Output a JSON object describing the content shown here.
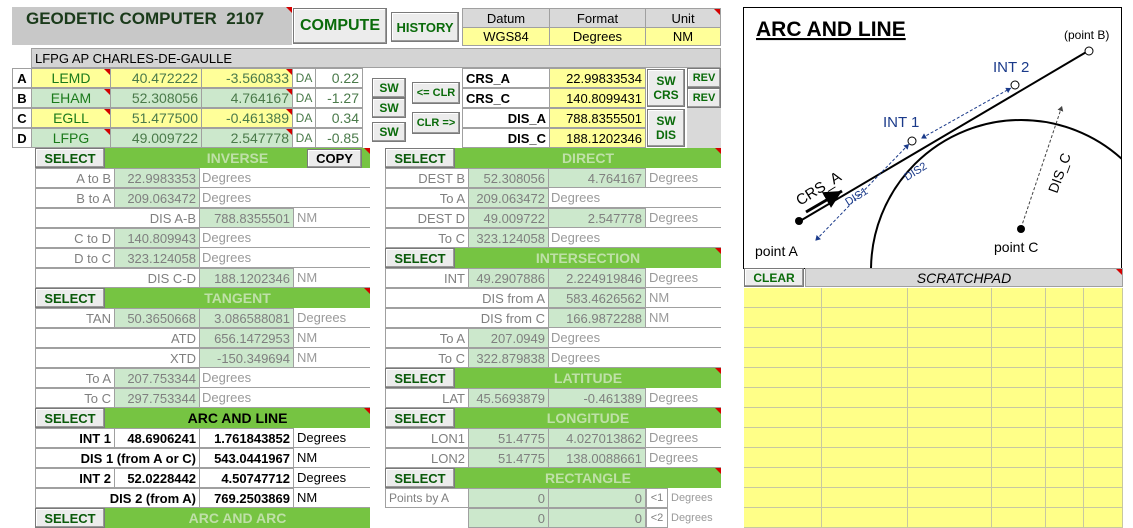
{
  "header": {
    "title": "GEODETIC COMPUTER  2107",
    "compute": "COMPUTE",
    "history": "HISTORY",
    "datum_label": "Datum",
    "format_label": "Format",
    "unit_label": "Unit",
    "datum": "WGS84",
    "format": "Degrees",
    "unit": "NM",
    "location": "LFPG AP CHARLES-DE-GAULLE"
  },
  "points": [
    {
      "letter": "A",
      "code": "LEMD",
      "lat": "40.472222",
      "lon": "-3.560833",
      "da": "DA",
      "daval": "0.22"
    },
    {
      "letter": "B",
      "code": "EHAM",
      "lat": "52.308056",
      "lon": "4.764167",
      "da": "DA",
      "daval": "-1.27"
    },
    {
      "letter": "C",
      "code": "EGLL",
      "lat": "51.477500",
      "lon": "-0.461389",
      "da": "DA",
      "daval": "0.34"
    },
    {
      "letter": "D",
      "code": "LFPG",
      "lat": "49.009722",
      "lon": "2.547778",
      "da": "DA",
      "daval": "-0.85"
    }
  ],
  "controls": {
    "sw": "SW",
    "clr_left": "<= CLR",
    "clr_right": "CLR =>",
    "sw_crs": "SW\nCRS",
    "sw_dis": "SW\nDIS",
    "rev": "REV",
    "select": "SELECT",
    "copy": "COPY",
    "clear": "CLEAR"
  },
  "crs": {
    "crs_a_label": "CRS_A",
    "crs_a": "22.99833534",
    "crs_c_label": "CRS_C",
    "crs_c": "140.8099431",
    "dis_a_label": "DIS_A",
    "dis_a": "788.8355501",
    "dis_c_label": "DIS_C",
    "dis_c": "188.1202346"
  },
  "inverse": {
    "title": "INVERSE",
    "atob_label": "A to B",
    "atob": "22.9983353",
    "atob_unit": "Degrees",
    "btoa_label": "B to A",
    "btoa": "209.063472",
    "btoa_unit": "Degrees",
    "disab_label": "DIS A-B",
    "disab": "788.8355501",
    "disab_unit": "NM",
    "ctod_label": "C to D",
    "ctod": "140.809943",
    "ctod_unit": "Degrees",
    "dtoc_label": "D to C",
    "dtoc": "323.124058",
    "dtoc_unit": "Degrees",
    "discd_label": "DIS C-D",
    "discd": "188.1202346",
    "discd_unit": "NM"
  },
  "tangent": {
    "title": "TANGENT",
    "tan_label": "TAN",
    "tan_lat": "50.3650668",
    "tan_lon": "3.086588081",
    "tan_unit": "Degrees",
    "atd_label": "ATD",
    "atd": "656.1472953",
    "atd_unit": "NM",
    "xtd_label": "XTD",
    "xtd": "-150.349694",
    "xtd_unit": "NM",
    "toa_label": "To A",
    "toa": "207.753344",
    "toa_unit": "Degrees",
    "toc_label": "To C",
    "toc": "297.753344",
    "toc_unit": "Degrees"
  },
  "arcline": {
    "title": "ARC AND LINE",
    "int1_label": "INT 1",
    "int1_lat": "48.6906241",
    "int1_lon": "1.761843852",
    "int1_unit": "Degrees",
    "dis1_label": "DIS 1 (from A or C)",
    "dis1": "543.0441967",
    "dis1_unit": "NM",
    "int2_label": "INT 2",
    "int2_lat": "52.0228442",
    "int2_lon": "4.50747712",
    "int2_unit": "Degrees",
    "dis2_label": "DIS 2 (from A)",
    "dis2": "769.2503869",
    "dis2_unit": "NM",
    "next_title": "ARC AND ARC"
  },
  "direct": {
    "title": "DIRECT",
    "destb_label": "DEST B",
    "destb_lat": "52.308056",
    "destb_lon": "4.764167",
    "destb_unit": "Degrees",
    "toa_label": "To A",
    "toa": "209.063472",
    "toa_unit": "Degrees",
    "destd_label": "DEST D",
    "destd_lat": "49.009722",
    "destd_lon": "2.547778",
    "destd_unit": "Degrees",
    "toc_label": "To C",
    "toc": "323.124058",
    "toc_unit": "Degrees"
  },
  "intersection": {
    "title": "INTERSECTION",
    "int_label": "INT",
    "int_lat": "49.2907886",
    "int_lon": "2.224919846",
    "int_unit": "Degrees",
    "disa_label": "DIS from A",
    "disa": "583.4626562",
    "disa_unit": "NM",
    "disc_label": "DIS from C",
    "disc": "166.9872288",
    "disc_unit": "NM",
    "toa_label": "To A",
    "toa": "207.0949",
    "toa_unit": "Degrees",
    "toc_label": "To C",
    "toc": "322.879838",
    "toc_unit": "Degrees"
  },
  "latitude": {
    "title": "LATITUDE",
    "lat_label": "LAT",
    "lat": "45.5693879",
    "lon": "-0.461389",
    "unit": "Degrees"
  },
  "longitude": {
    "title": "LONGITUDE",
    "lon1_label": "LON1",
    "lon1_lat": "51.4775",
    "lon1_lon": "4.027013862",
    "lon1_unit": "Degrees",
    "lon2_label": "LON2",
    "lon2_lat": "51.4775",
    "lon2_lon": "138.0088661",
    "lon2_unit": "Degrees"
  },
  "rectangle": {
    "title": "RECTANGLE",
    "points_label": "Points by A",
    "v1": "0",
    "v2": "0",
    "tag1": "<1",
    "tag2": "<2",
    "unit": "Degrees"
  },
  "diagram": {
    "title": "ARC AND LINE",
    "point_b": "(point B)",
    "int2": "INT 2",
    "int1": "INT 1",
    "crs_a": "CRS_A",
    "dis1": "DIS1",
    "dis2": "DIS2",
    "dis_c": "DIS_C",
    "point_a": "point A",
    "point_c": "point C"
  },
  "scratchpad": {
    "title": "SCRATCHPAD"
  }
}
